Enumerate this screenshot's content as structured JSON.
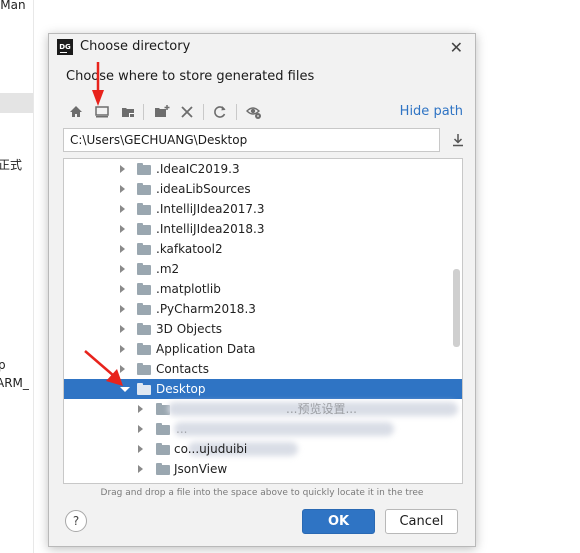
{
  "background": {
    "frag_top": "BMan",
    "frag_mid1": "正式",
    "frag_mid2": "p",
    "frag_mid3": "ARM_"
  },
  "dialog": {
    "title": "Choose directory",
    "app_badge": "DG",
    "description": "Choose where to store generated files",
    "hide_path_label": "Hide path",
    "path_value": "C:\\Users\\GECHUANG\\Desktop",
    "hint": "Drag and drop a file into the space above to quickly locate it in the tree",
    "help_label": "?",
    "ok_label": "OK",
    "cancel_label": "Cancel"
  },
  "toolbar_icons": [
    "home-icon",
    "desktop-icon",
    "project-folder-icon",
    "new-folder-icon",
    "delete-icon",
    "refresh-icon",
    "show-hidden-icon"
  ],
  "tree": {
    "items": [
      {
        "label": ".IdeaIC2019.3"
      },
      {
        "label": ".ideaLibSources"
      },
      {
        "label": ".IntelliJIdea2017.3"
      },
      {
        "label": ".IntelliJIdea2018.3"
      },
      {
        "label": ".kafkatool2"
      },
      {
        "label": ".m2"
      },
      {
        "label": ".matplotlib"
      },
      {
        "label": ".PyCharm2018.3"
      },
      {
        "label": "3D Objects"
      },
      {
        "label": "Application Data"
      },
      {
        "label": "Contacts"
      },
      {
        "label": "Desktop"
      }
    ],
    "children": [
      {
        "label": "...预览设置..."
      },
      {
        "label": "..."
      },
      {
        "label": "co...ujuduibi"
      },
      {
        "label": "JsonView"
      }
    ]
  },
  "colors": {
    "accent": "#2f74c4",
    "arrow": "#e8231c"
  }
}
